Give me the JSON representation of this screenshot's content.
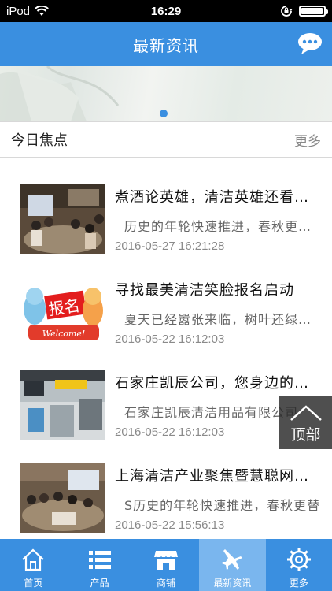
{
  "status_bar": {
    "carrier": "iPod",
    "time": "16:29",
    "battery_level": 0.95
  },
  "header": {
    "title": "最新资讯",
    "chat_icon": "chat-bubble-icon"
  },
  "banner": {
    "page_indicator_active": 1
  },
  "section": {
    "title": "今日焦点",
    "more_label": "更多"
  },
  "news": [
    {
      "title": "煮酒论英雄，清洁英雄还看凯辰",
      "summary": "历史的年轮快速推进，春秋更替，",
      "date": "2016-05-27 16:21:28"
    },
    {
      "title": "寻找最美清洁笑脸报名启动",
      "summary": "夏天已经嚣张来临，树叶还绿得发亮",
      "date": "2016-05-22 16:12:03"
    },
    {
      "title": "石家庄凯辰公司，您身边的清洁专家",
      "summary": "石家庄凯辰清洁用品有限公司",
      "date": "2016-05-22 16:12:03"
    },
    {
      "title": "上海清洁产业聚焦暨慧聪网年会",
      "summary": "S历史的年轮快速推进，春秋更替",
      "date": "2016-05-22 15:56:13"
    }
  ],
  "back_to_top": {
    "label": "顶部"
  },
  "tabs": [
    {
      "label": "首页",
      "icon": "home-icon"
    },
    {
      "label": "产品",
      "icon": "list-icon"
    },
    {
      "label": "商铺",
      "icon": "store-icon"
    },
    {
      "label": "最新资讯",
      "icon": "plane-icon",
      "active": true
    },
    {
      "label": "更多",
      "icon": "gear-icon"
    }
  ],
  "colors": {
    "accent": "#3a8fe0",
    "active_tab": "#7ab6ee"
  }
}
